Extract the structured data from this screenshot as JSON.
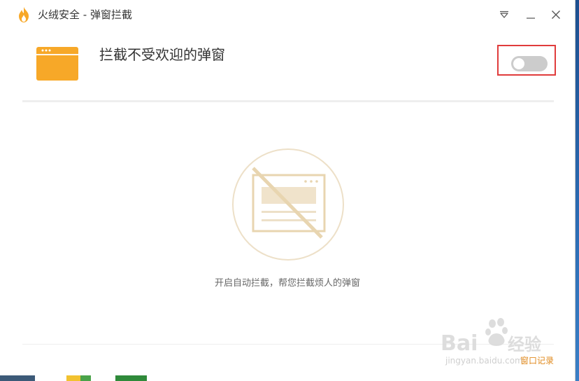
{
  "window": {
    "title": "火绒安全 - 弹窗拦截"
  },
  "titlebar_buttons": {
    "menu_icon": "menu-triangle-icon",
    "minimize_icon": "minimize-icon",
    "close_icon": "close-icon"
  },
  "header": {
    "feature_title": "拦截不受欢迎的弹窗",
    "feature_icon": "browser-window-icon",
    "toggle_state": "off"
  },
  "empty_state": {
    "illustration": "blocked-popup-icon",
    "hint": "开启自动拦截，帮您拦截烦人的弹窗"
  },
  "footer": {
    "history_link": "窗口记录"
  },
  "watermark": {
    "brand": "Baidu经验",
    "sub": "jingyan.baidu.com"
  },
  "colors": {
    "accent_orange": "#F7A828",
    "link_orange": "#E08A1E",
    "toggle_off": "#CCCCCC",
    "highlight_red": "#E03C3C",
    "illustration_tan": "#E8D5B0"
  }
}
